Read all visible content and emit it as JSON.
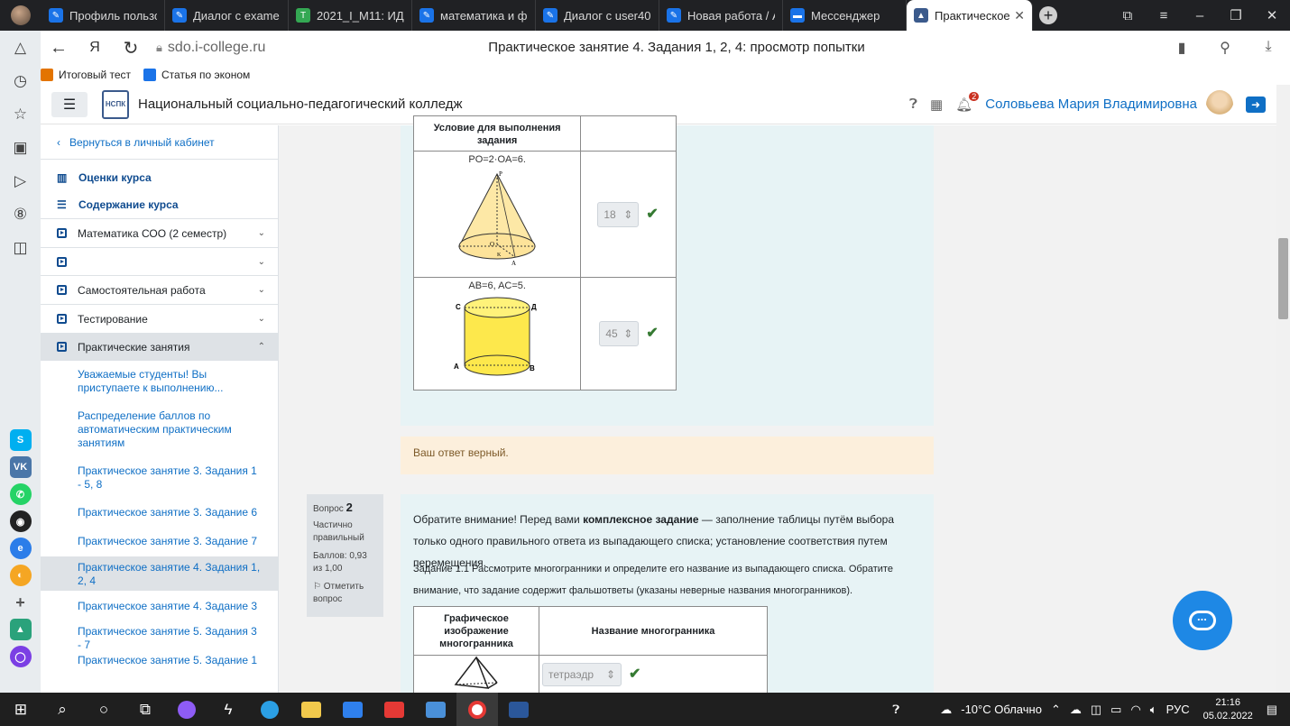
{
  "browser": {
    "tabs": [
      {
        "label": "Профиль пользо",
        "icon_color": "#1a73e8"
      },
      {
        "label": "Диалог с exame",
        "icon_color": "#1a73e8"
      },
      {
        "label": "2021_I_М11: ИДЗ",
        "icon_color": "#34a853"
      },
      {
        "label": "математика и фи",
        "icon_color": "#1a73e8"
      },
      {
        "label": "Диалог с user405",
        "icon_color": "#1a73e8"
      },
      {
        "label": "Новая работа / А",
        "icon_color": "#1a73e8"
      },
      {
        "label": "Мессенджер",
        "icon_color": "#1a73e8"
      },
      {
        "label": "Практическое",
        "icon_color": "#3b5a8c",
        "active": true
      }
    ],
    "url": "sdo.i-college.ru",
    "page_title": "Практическое занятие 4. Задания 1, 2, 4: просмотр попытки",
    "bookmarks": [
      {
        "label": "Итоговый тест",
        "icon_color": "#e37400"
      },
      {
        "label": "Статья по эконом",
        "icon_color": "#1a73e8"
      }
    ]
  },
  "header": {
    "college": "Национальный социально-педагогический колледж",
    "logo_text": "НСПК",
    "notif_count": "2",
    "user": "Соловьева Мария Владимировна"
  },
  "drawer": {
    "back": "Вернуться в личный кабинет",
    "grades": "Оценки курса",
    "contents": "Содержание курса",
    "sections": [
      {
        "label": "Математика СОО (2 семестр)"
      },
      {
        "label": ""
      },
      {
        "label": "Самостоятельная работа"
      },
      {
        "label": "Тестирование"
      },
      {
        "label": "Практические занятия"
      }
    ],
    "links": [
      "Уважаемые студенты! Вы приступаете к выполнению...",
      "Распределение баллов по автоматическим практическим занятиям",
      "Практическое занятие 3. Задания 1 - 5, 8",
      "Практическое занятие 3. Задание 6",
      "Практическое занятие 3. Задание 7",
      "Практическое занятие 4. Задания 1, 2, 4",
      "Практическое занятие 4. Задание 3",
      "Практическое занятие 5. Задания 3 - 7",
      "Практическое занятие 5. Задание 1"
    ]
  },
  "q1": {
    "header_cell": "Условие для выполнения задания",
    "row1_cond": "PO=2·OA=6.",
    "row1_value": "18",
    "row2_cond": "AB=6, AC=5.",
    "row2_value": "45",
    "cone_labels": {
      "p": "P",
      "o": "O",
      "k": "K",
      "a": "A"
    },
    "cyl_labels": {
      "c": "С",
      "d": "Д",
      "a": "А",
      "b": "В"
    },
    "feedback": "Ваш ответ верный."
  },
  "q2": {
    "label": "Вопрос",
    "number": "2",
    "status": "Частично правильный",
    "score": "Баллов: 0,93 из 1,00",
    "flag": "Отметить вопрос",
    "intro_a": "Обратите внимание! Перед вами ",
    "intro_b": "комплексное задание",
    "intro_c": " — заполнение таблицы путём выбора только одного правильного ответа из выпадающего списка; установление соответствия путем перемещения.",
    "task": "Задание 1.1 Рассмотрите многогранники и определите его название из выпадающего списка. Обратите внимание, что задание содержит фальшответы (указаны неверные названия многогранников).",
    "col1": "Графическое изображение многогранника",
    "col2": "Название многогранника",
    "row1_value": "тетраэдр"
  },
  "taskbar": {
    "weather": "-10°C  Облачно",
    "lang": "РУС",
    "time": "21:16",
    "date": "05.02.2022"
  }
}
